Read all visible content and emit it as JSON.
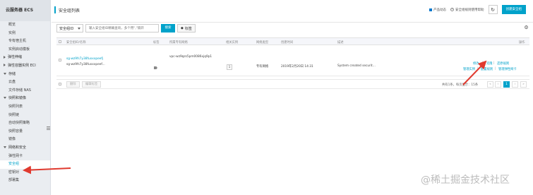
{
  "sidebar": {
    "title": "云服务器 ECS",
    "items": [
      {
        "label": "概览",
        "type": "item"
      },
      {
        "label": "实例",
        "type": "item"
      },
      {
        "label": "专有宿主机",
        "type": "item"
      },
      {
        "label": "实例启动模板",
        "type": "item"
      },
      {
        "label": "弹性伸缩",
        "type": "group",
        "collapsed": true
      },
      {
        "label": "弹性容器实例 ECI",
        "type": "group",
        "collapsed": true
      },
      {
        "label": "存储",
        "type": "group",
        "collapsed": false
      },
      {
        "label": "云盘",
        "type": "item"
      },
      {
        "label": "文件存储 NAS",
        "type": "item"
      },
      {
        "label": "快照和镜像",
        "type": "group",
        "collapsed": false
      },
      {
        "label": "快照列表",
        "type": "item"
      },
      {
        "label": "快照链",
        "type": "item"
      },
      {
        "label": "自动快照策略",
        "type": "item"
      },
      {
        "label": "快照容量",
        "type": "item"
      },
      {
        "label": "镜像",
        "type": "item"
      },
      {
        "label": "网络和安全",
        "type": "group",
        "collapsed": false
      },
      {
        "label": "弹性网卡",
        "type": "item"
      },
      {
        "label": "安全组",
        "type": "item",
        "active": true
      },
      {
        "label": "密钥对",
        "type": "item"
      },
      {
        "label": "部署集",
        "type": "item"
      }
    ]
  },
  "header": {
    "title": "安全组列表",
    "product_news": "产品动态",
    "security_group_help": "安全组规则使用帮助",
    "refresh_icon": "refresh-icon",
    "create_button": "创建安全组"
  },
  "toolbar": {
    "select_value": "安全组ID",
    "search_placeholder": "输入安全组ID精确查询，多个用\",\"隔开",
    "search_button": "搜索",
    "tag_button": "标签"
  },
  "table": {
    "columns": [
      "安全组ID/名称",
      "标签",
      "所属专有网络",
      "相关实例",
      "网络类型",
      "创建时间",
      "描述",
      "操作"
    ],
    "rows": [
      {
        "id": "sg-wz9fs7y38fuxxxpeefj",
        "name": "sg-wz9fs7y38fuxxxpeef...",
        "vpc": "vpc-wz9qzs5pm0086xjq9p1",
        "instances": "1",
        "network_type": "专有网络",
        "created": "2019年2月20日 14:31",
        "description": "System created securit...",
        "actions_row1": [
          "修改",
          "克隆",
          "还原规则"
        ],
        "actions_row2": [
          "管理实例",
          "配置规则",
          "管理弹性网卡"
        ]
      }
    ]
  },
  "footer": {
    "delete_button": "删除",
    "edit_tags_button": "编辑标签",
    "page_info": "共有1条，每页显示：15条",
    "pager": [
      "«",
      "‹",
      "1",
      "›",
      "»"
    ],
    "current_page": "1"
  },
  "watermark": "@稀土掘金技术社区",
  "colors": {
    "accent": "#00a2ca",
    "arrow": "#e03a2f"
  }
}
